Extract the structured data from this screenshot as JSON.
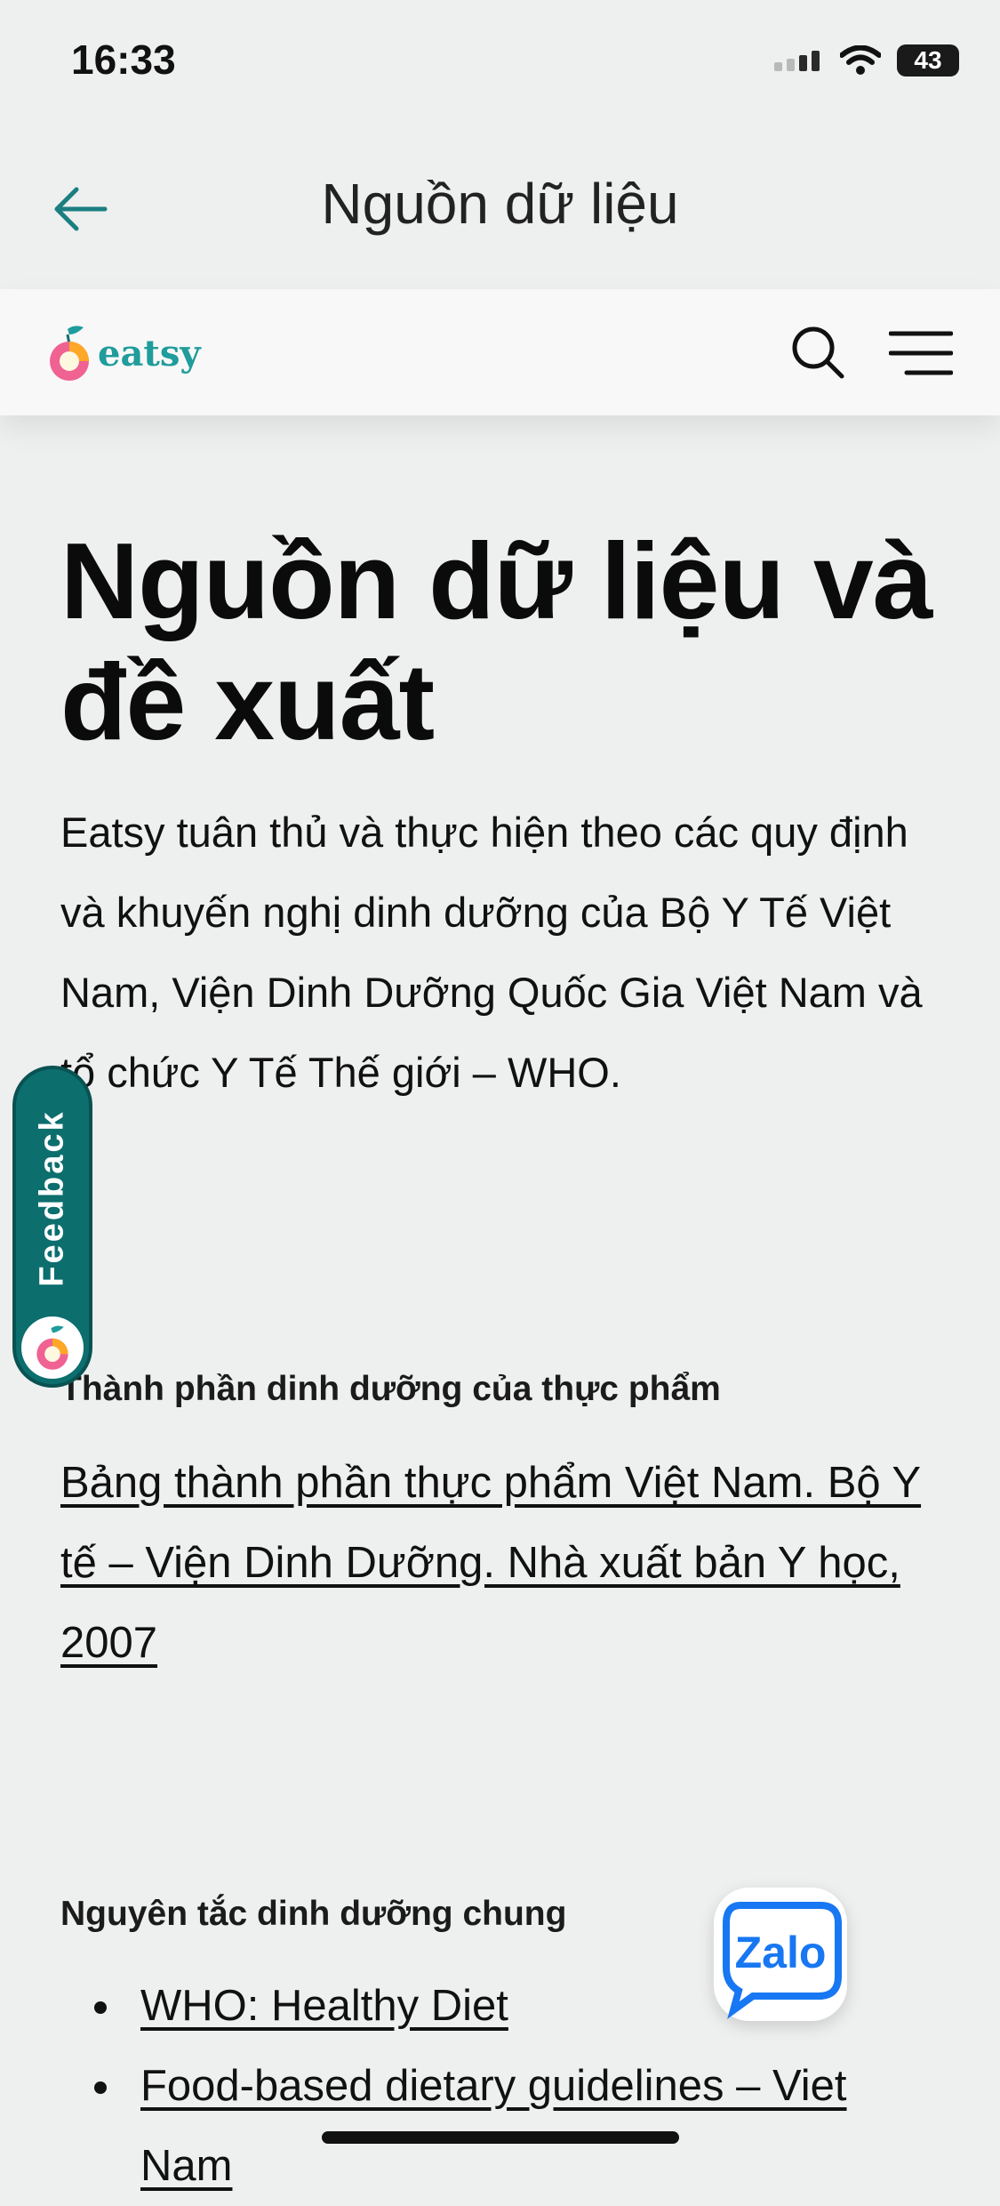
{
  "status_bar": {
    "time": "16:33",
    "battery": "43"
  },
  "nav": {
    "title": "Nguồn dữ liệu"
  },
  "header": {
    "logo_text": "eatsy"
  },
  "page": {
    "heading_line1": "Nguồn dữ liệu và",
    "heading_line2": "đề xuất",
    "intro": "Eatsy tuân thủ và thực hiện theo các quy định và khuyến nghị dinh dưỡng của Bộ Y Tế Việt Nam, Viện Dinh Dưỡng Quốc Gia Việt Nam và tổ chức Y Tế Thế giới – WHO."
  },
  "sections": [
    {
      "label": "Thành phần dinh dưỡng của thực phẩm",
      "link": "Bảng thành phần thực phẩm Việt Nam. Bộ Y tế – Viện Dinh Dưỡng. Nhà xuất bản Y học, 2007"
    },
    {
      "label": "Nguyên tắc dinh dưỡng chung",
      "links": [
        "WHO: Healthy Diet",
        "Food-based dietary guidelines – Viet Nam"
      ]
    }
  ],
  "feedback": {
    "label": "Feedback"
  },
  "zalo": {
    "label": "Zalo"
  },
  "colors": {
    "teal": "#1f9c9b",
    "feedback_bg": "#0d6e6e",
    "zalo_blue": "#1877f2",
    "background": "#eeefef"
  }
}
